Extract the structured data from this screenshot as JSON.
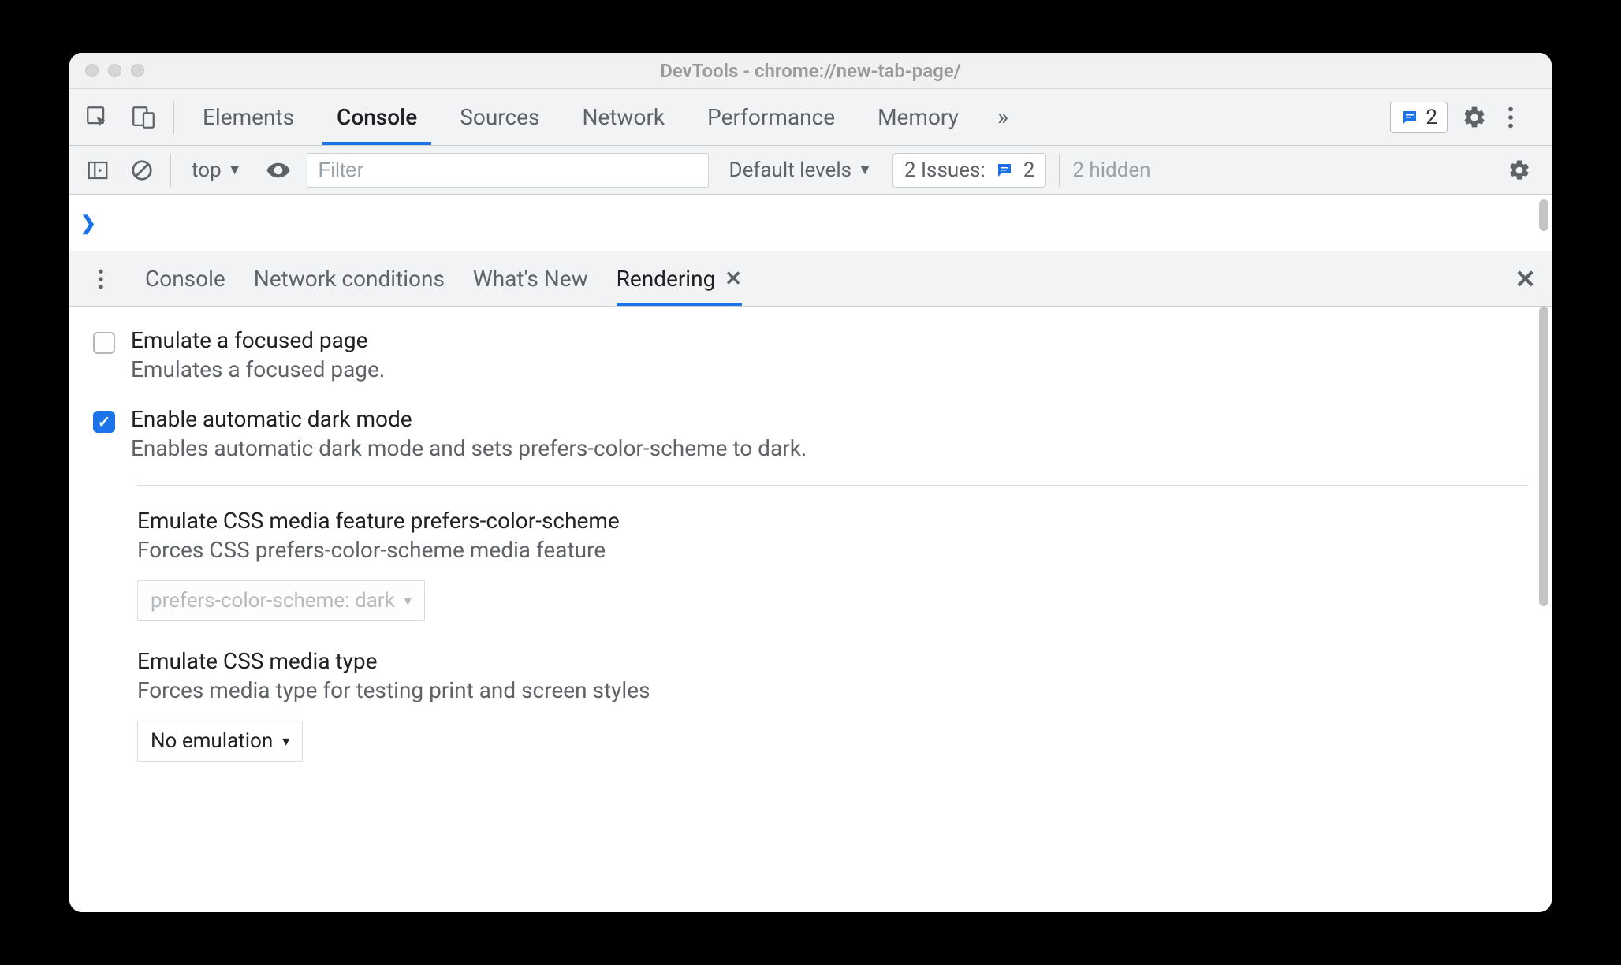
{
  "window": {
    "title": "DevTools - chrome://new-tab-page/"
  },
  "mainTabs": {
    "elements": "Elements",
    "console": "Console",
    "sources": "Sources",
    "network": "Network",
    "performance": "Performance",
    "memory": "Memory",
    "more": "»",
    "badgeCount": "2"
  },
  "consoleToolbar": {
    "context": "top",
    "filterPlaceholder": "Filter",
    "levels": "Default levels",
    "issuesLabel": "2 Issues:",
    "issuesCount": "2",
    "hidden": "2 hidden"
  },
  "drawer": {
    "tabs": {
      "console": "Console",
      "network_conditions": "Network conditions",
      "whats_new": "What's New",
      "rendering": "Rendering"
    }
  },
  "rendering": {
    "opt1": {
      "title": "Emulate a focused page",
      "desc": "Emulates a focused page.",
      "checked": false
    },
    "opt2": {
      "title": "Enable automatic dark mode",
      "desc": "Enables automatic dark mode and sets prefers-color-scheme to dark.",
      "checked": true
    },
    "sec1": {
      "title": "Emulate CSS media feature prefers-color-scheme",
      "desc": "Forces CSS prefers-color-scheme media feature",
      "value": "prefers-color-scheme: dark"
    },
    "sec2": {
      "title": "Emulate CSS media type",
      "desc": "Forces media type for testing print and screen styles",
      "value": "No emulation"
    }
  }
}
